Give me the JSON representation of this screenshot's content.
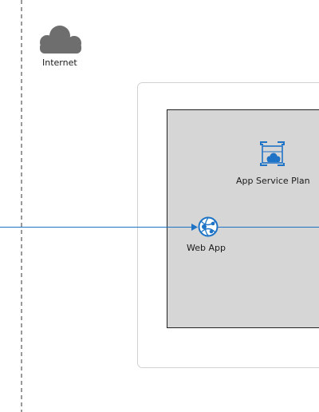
{
  "internet": {
    "label": "Internet",
    "icon": "cloud-icon"
  },
  "plan": {
    "label": "App Service Plan",
    "icon": "app-service-plan-icon"
  },
  "webapp": {
    "label": "Web App",
    "icon": "web-app-icon"
  },
  "colors": {
    "accent": "#1e73c6",
    "cloud": "#6e6e6e",
    "plan_fill": "#d6d6d6",
    "plan_border": "#222222",
    "outer_border": "#d2d2d2",
    "boundary": "#333333"
  }
}
